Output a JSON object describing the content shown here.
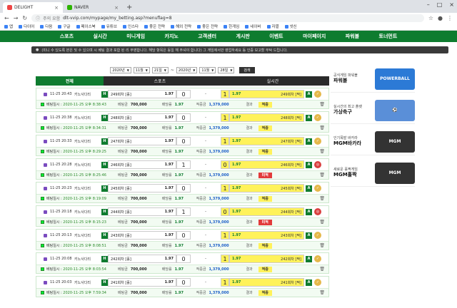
{
  "browser": {
    "tabs": [
      {
        "label": "DELIGHT"
      },
      {
        "label": "NAVER"
      }
    ],
    "url": "dlt-vvip.com/mypage/my_betting.asp?menuflag=8",
    "security_label": "주의 요함",
    "bookmarks": [
      "앱",
      "다이어",
      "다음",
      "구글",
      "페이스북",
      "유튜브",
      "인스타",
      "좋은 전략",
      "해외 전략",
      "좋은 전략",
      "한게임",
      "네이버",
      "자멸",
      "넷신"
    ]
  },
  "site_nav": {
    "items": [
      "",
      "스포츠",
      "실시간",
      "미니게임",
      "카지노",
      "",
      "고객센터",
      "게시판",
      "이벤트",
      "마이페이지",
      "",
      "",
      "",
      "파워볼",
      "토너먼트"
    ]
  },
  "notice": {
    "text": "(미니 수 있도록 본은 및 수 있으며 시 베팅 결과 포함 된 리 부영합니다. 해당 항목은 동일 해 주셔야 합니다) 그 게임에서만 영업하세요 동 인증 보고할 부탁 드립니다."
  },
  "filter": {
    "start_year": "2020년",
    "start_month": "11월",
    "start_day": "21일",
    "separator": "~",
    "end_year": "2020년",
    "end_month": "11월",
    "end_day": "28일",
    "search_label": "검색"
  },
  "categories": [
    "전체",
    "스포츠",
    "실시간"
  ],
  "common": {
    "home_letter": "H",
    "away_letter": "A",
    "bet_amount_label": "베팅금",
    "odds_label": "배당률",
    "win_amount_label": "적중금",
    "result_label": "결과",
    "date_prefix": "베팅일시 :",
    "currency": "원",
    "dash": "-"
  },
  "bets": [
    {
      "time": "11-25 20:43",
      "league": "키노사다리",
      "home_name": "249회차 [홀]",
      "home_odds": "1.97",
      "home_score": "0",
      "away_score": "1",
      "away_odds": "1.97",
      "away_name": "249회차 [짝]",
      "bet_date": "2020-11-25 오후 8:38:43",
      "bet_amount": "700,000",
      "odds": "1.97",
      "win_amount": "1,379,000",
      "status": "적중",
      "outcome": "win"
    },
    {
      "time": "11-25 20:38",
      "league": "키노사다리",
      "home_name": "248회차 [홀]",
      "home_odds": "1.97",
      "home_score": "0",
      "away_score": "1",
      "away_odds": "1.97",
      "away_name": "248회차 [짝]",
      "bet_date": "2020-11-25 오후 8:34:31",
      "bet_amount": "700,000",
      "odds": "1.97",
      "win_amount": "1,379,000",
      "status": "적중",
      "outcome": "win"
    },
    {
      "time": "11-25 20:33",
      "league": "키노사다리",
      "home_name": "247회차 [홀]",
      "home_odds": "1.97",
      "home_score": "0",
      "away_score": "1",
      "away_odds": "1.97",
      "away_name": "247회차 [짝]",
      "bet_date": "2020-11-25 오후 8:29:25",
      "bet_amount": "700,000",
      "odds": "1.97",
      "win_amount": "1,379,000",
      "status": "적중",
      "outcome": "win"
    },
    {
      "time": "11-25 20:28",
      "league": "키노사다리",
      "home_name": "246회차 [홀]",
      "home_odds": "1.97",
      "home_score": "1",
      "away_score": "0",
      "away_odds": "1.97",
      "away_name": "246회차 [짝]",
      "bet_date": "2020-11-25 오후 8:25:46",
      "bet_amount": "700,000",
      "odds": "1.97",
      "win_amount": "1,379,000",
      "status": "미적",
      "outcome": "lose"
    },
    {
      "time": "11-25 20:23",
      "league": "키노사다리",
      "home_name": "245회차 [홀]",
      "home_odds": "1.97",
      "home_score": "0",
      "away_score": "1",
      "away_odds": "1.97",
      "away_name": "245회차 [짝]",
      "bet_date": "2020-11-25 오후 8:19:09",
      "bet_amount": "700,000",
      "odds": "1.97",
      "win_amount": "1,379,000",
      "status": "적중",
      "outcome": "win"
    },
    {
      "time": "11-25 20:18",
      "league": "키노사다리",
      "home_name": "244회차 [홀]",
      "home_odds": "1.97",
      "home_score": "1",
      "away_score": "0",
      "away_odds": "1.97",
      "away_name": "244회차 [짝]",
      "bet_date": "2020-11-25 오후 8:15:23",
      "bet_amount": "700,000",
      "odds": "1.97",
      "win_amount": "1,379,000",
      "status": "미적",
      "outcome": "lose"
    },
    {
      "time": "11-25 20:13",
      "league": "키노사다리",
      "home_name": "243회차 [홀]",
      "home_odds": "1.97",
      "home_score": "0",
      "away_score": "1",
      "away_odds": "1.97",
      "away_name": "243회차 [짝]",
      "bet_date": "2020-11-25 오후 8:08:51",
      "bet_amount": "700,000",
      "odds": "1.97",
      "win_amount": "1,379,000",
      "status": "적중",
      "outcome": "win"
    },
    {
      "time": "11-25 20:08",
      "league": "키노사다리",
      "home_name": "242회차 [홀]",
      "home_odds": "1.97",
      "home_score": "0",
      "away_score": "1",
      "away_odds": "1.97",
      "away_name": "242회차 [짝]",
      "bet_date": "2020-11-25 오후 8:03:54",
      "bet_amount": "700,000",
      "odds": "1.97",
      "win_amount": "1,379,000",
      "status": "적중",
      "outcome": "win"
    },
    {
      "time": "11-25 20:03",
      "league": "키노사다리",
      "home_name": "241회차 [홀]",
      "home_odds": "1.97",
      "home_score": "0",
      "away_score": "1",
      "away_odds": "1.97",
      "away_name": "241회차 [짝]",
      "bet_date": "2020-11-25 오후 7:59:34",
      "bet_amount": "700,000",
      "odds": "1.97",
      "win_amount": "1,379,000",
      "status": "적중",
      "outcome": "win"
    }
  ],
  "sidebar_ads": [
    {
      "caption": "공식게임 파워볼",
      "title": "파워볼",
      "logo": "POWERBALL",
      "color": "#2c7ad6"
    },
    {
      "caption": "실시간의 최고 플랫",
      "title": "가상축구",
      "logo": "⚽",
      "color": "#5a8fd8"
    },
    {
      "caption": "인기폭발 바카라",
      "title": "MGM바카라",
      "logo": "MGM",
      "color": "#333333"
    },
    {
      "caption": "새로운 홀짝게임",
      "title": "MGM홀짝",
      "logo": "MGM",
      "color": "#333333"
    }
  ],
  "colors": {
    "brand_green": "#0e7c2f",
    "highlight_yellow": "#fff25a",
    "win": "#e5b84a",
    "lose": "#d94040"
  }
}
